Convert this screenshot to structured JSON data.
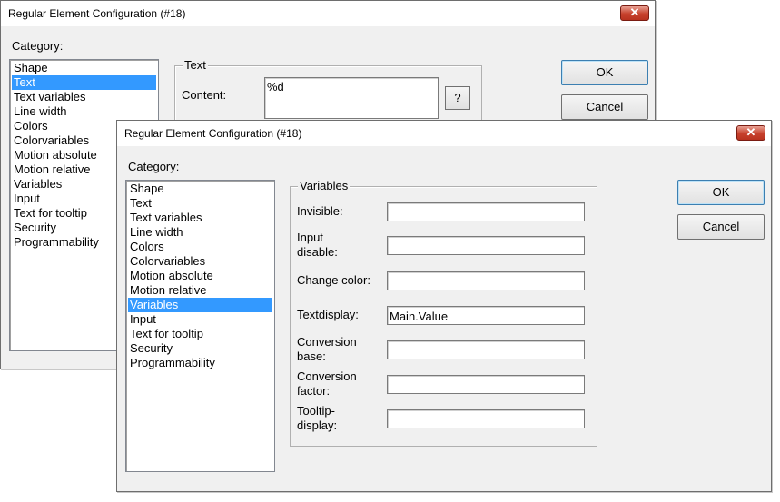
{
  "back_dialog": {
    "title": "Regular Element Configuration (#18)",
    "close_glyph": "✕",
    "category_label": "Category:",
    "categories": [
      "Shape",
      "Text",
      "Text variables",
      "Line width",
      "Colors",
      "Colorvariables",
      "Motion absolute",
      "Motion relative",
      "Variables",
      "Input",
      "Text for tooltip",
      "Security",
      "Programmability"
    ],
    "selected_category": "Text",
    "group_title": "Text",
    "content_label": "Content:",
    "content_value": "%d",
    "help_label": "?",
    "ok_label": "OK",
    "cancel_label": "Cancel"
  },
  "front_dialog": {
    "title": "Regular Element Configuration (#18)",
    "close_glyph": "✕",
    "category_label": "Category:",
    "categories": [
      "Shape",
      "Text",
      "Text variables",
      "Line width",
      "Colors",
      "Colorvariables",
      "Motion absolute",
      "Motion relative",
      "Variables",
      "Input",
      "Text for tooltip",
      "Security",
      "Programmability"
    ],
    "selected_category": "Variables",
    "group_title": "Variables",
    "fields": [
      {
        "label_line1": "Invisible:",
        "label_line2": "",
        "value": ""
      },
      {
        "label_line1": "Input",
        "label_line2": "disable:",
        "value": ""
      },
      {
        "label_line1": "Change color:",
        "label_line2": "",
        "value": ""
      },
      {
        "label_line1": "Textdisplay:",
        "label_line2": "",
        "value": "Main.Value"
      },
      {
        "label_line1": "Conversion",
        "label_line2": "base:",
        "value": ""
      },
      {
        "label_line1": "Conversion",
        "label_line2": "factor:",
        "value": ""
      },
      {
        "label_line1": "Tooltip-",
        "label_line2": "display:",
        "value": ""
      }
    ],
    "ok_label": "OK",
    "cancel_label": "Cancel"
  },
  "colors": {
    "selection": "#3399ff",
    "dialog_bg": "#f0f0f0",
    "close_button": "#c7412c"
  }
}
